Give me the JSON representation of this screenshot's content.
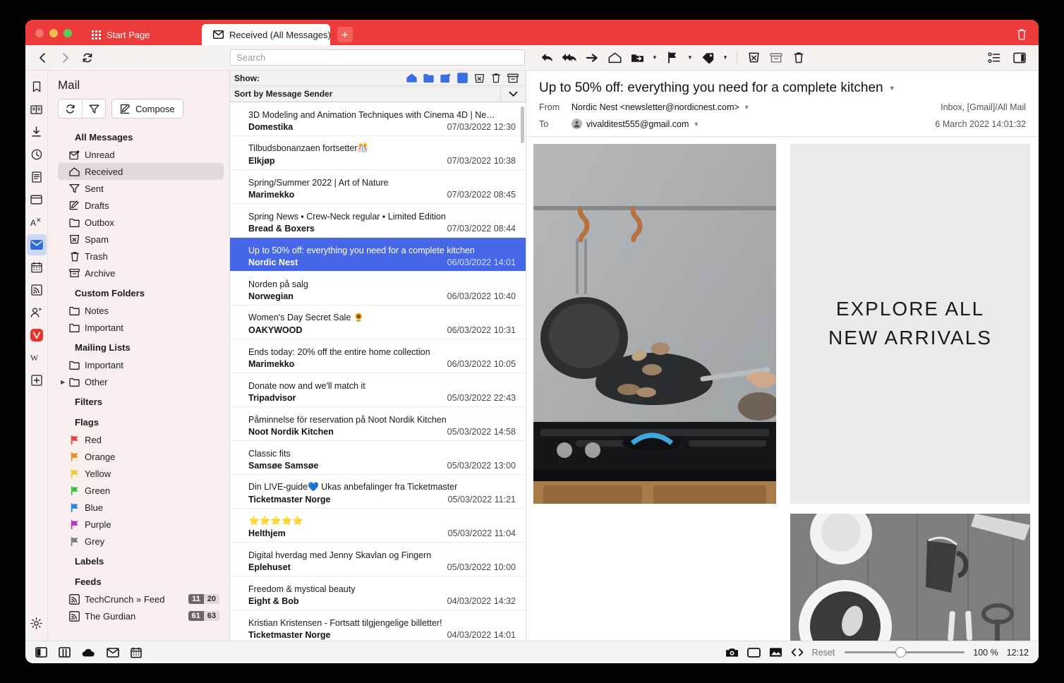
{
  "window": {
    "accent_color": "#ED3B3B",
    "selection_color": "#4668E8",
    "tabs": [
      {
        "label": "Start Page",
        "icon": "grid-icon",
        "active": false
      },
      {
        "label": "Received (All Messages)",
        "icon": "mail-icon",
        "active": true
      }
    ],
    "new_tab_label": "+",
    "trash_icon": "trash-icon"
  },
  "navbar": {
    "back": "back-arrow-icon",
    "forward": "forward-arrow-icon",
    "reload": "reload-icon",
    "search": {
      "value": "",
      "placeholder": "Search"
    }
  },
  "mail_toolbar": {
    "items": [
      {
        "name": "reply-button",
        "icon": "reply-icon"
      },
      {
        "name": "reply-all-button",
        "icon": "reply-all-icon"
      },
      {
        "name": "forward-button",
        "icon": "forward-icon"
      },
      {
        "name": "mark-unread-button",
        "icon": "open-envelope-icon"
      },
      {
        "name": "move-to-folder-button",
        "icon": "folder-move-icon",
        "has_caret": true
      },
      {
        "name": "flag-button",
        "icon": "flag-icon",
        "has_caret": true
      },
      {
        "name": "label-button",
        "icon": "tag-icon",
        "has_caret": true
      },
      {
        "name": "mark-spam-button",
        "icon": "spam-icon"
      },
      {
        "name": "archive-button",
        "icon": "archive-icon"
      },
      {
        "name": "delete-button",
        "icon": "trash-icon"
      }
    ],
    "right": [
      {
        "name": "message-list-options-button",
        "icon": "list-tree-icon"
      },
      {
        "name": "toggle-panel-button",
        "icon": "panel-toggle-icon"
      }
    ]
  },
  "rail": {
    "items": [
      {
        "name": "bookmarks",
        "icon": "bookmark-icon",
        "active": false
      },
      {
        "name": "reading-list",
        "icon": "book-icon",
        "active": false
      },
      {
        "name": "downloads",
        "icon": "download-icon",
        "active": false
      },
      {
        "name": "history",
        "icon": "clock-icon",
        "active": false
      },
      {
        "name": "notes",
        "icon": "notes-icon",
        "active": false
      },
      {
        "name": "window-panel",
        "icon": "window-icon",
        "active": false
      },
      {
        "name": "translate",
        "icon": "translate-icon",
        "active": false
      },
      {
        "name": "mail",
        "icon": "mail-icon",
        "active": true
      },
      {
        "name": "calendar",
        "icon": "calendar-icon",
        "active": false
      },
      {
        "name": "feeds",
        "icon": "rss-icon",
        "active": false
      },
      {
        "name": "contacts",
        "icon": "contacts-icon",
        "active": false
      },
      {
        "name": "vivaldi-web-panel",
        "icon": "vivaldi-logo-icon",
        "active": false
      },
      {
        "name": "wikipedia-web-panel",
        "icon": "wikipedia-icon",
        "active": false
      },
      {
        "name": "add-web-panel",
        "icon": "plus-box-icon",
        "active": false
      }
    ],
    "settings": {
      "name": "settings",
      "icon": "gear-icon"
    }
  },
  "panel": {
    "title": "Mail",
    "actions": {
      "refresh": "refresh-icon",
      "filter": "filter-icon",
      "compose_label": "Compose",
      "compose_icon": "compose-icon"
    },
    "groups": [
      {
        "header": "All Messages",
        "items": [
          {
            "label": "Unread",
            "icon": "unread-mail-icon",
            "selected": false
          },
          {
            "label": "Received",
            "icon": "received-icon",
            "selected": true
          },
          {
            "label": "Sent",
            "icon": "sent-icon",
            "selected": false
          },
          {
            "label": "Drafts",
            "icon": "draft-icon",
            "selected": false
          },
          {
            "label": "Outbox",
            "icon": "folder-icon",
            "selected": false
          },
          {
            "label": "Spam",
            "icon": "spam-icon",
            "selected": false
          },
          {
            "label": "Trash",
            "icon": "trash-icon",
            "selected": false
          },
          {
            "label": "Archive",
            "icon": "archive-icon",
            "selected": false
          }
        ]
      },
      {
        "header": "Custom Folders",
        "items": [
          {
            "label": "Notes",
            "icon": "folder-icon",
            "selected": false
          },
          {
            "label": "Important",
            "icon": "folder-icon",
            "selected": false
          }
        ]
      },
      {
        "header": "Mailing Lists",
        "items": [
          {
            "label": "Important",
            "icon": "folder-icon",
            "selected": false
          },
          {
            "label": "Other",
            "icon": "folder-icon",
            "selected": false,
            "disclosure": true
          }
        ]
      },
      {
        "header": "Filters",
        "items": []
      },
      {
        "header": "Flags",
        "items": [
          {
            "label": "Red",
            "icon": "flag-icon",
            "color": "#E8453C",
            "selected": false
          },
          {
            "label": "Orange",
            "icon": "flag-icon",
            "color": "#F08B21",
            "selected": false
          },
          {
            "label": "Yellow",
            "icon": "flag-icon",
            "color": "#F2CB32",
            "selected": false
          },
          {
            "label": "Green",
            "icon": "flag-icon",
            "color": "#34C240",
            "selected": false
          },
          {
            "label": "Blue",
            "icon": "flag-icon",
            "color": "#2A82E8",
            "selected": false
          },
          {
            "label": "Purple",
            "icon": "flag-icon",
            "color": "#B333C6",
            "selected": false
          },
          {
            "label": "Grey",
            "icon": "flag-icon",
            "color": "#7C7C7C",
            "selected": false
          }
        ]
      },
      {
        "header": "Labels",
        "items": []
      },
      {
        "header": "Feeds",
        "items": [
          {
            "label": "TechCrunch » Feed",
            "icon": "rss-icon",
            "selected": false,
            "unread": "11",
            "total": "20"
          },
          {
            "label": "The Gurdian",
            "icon": "rss-icon",
            "selected": false,
            "unread": "61",
            "total": "63"
          }
        ]
      }
    ]
  },
  "message_list": {
    "show_label": "Show:",
    "show_filters": [
      {
        "name": "filter-received",
        "icon": "received-icon",
        "active": true
      },
      {
        "name": "filter-folders",
        "icon": "folder-icon",
        "active": true
      },
      {
        "name": "filter-unread",
        "icon": "unread-mail-icon",
        "active": true
      },
      {
        "name": "filter-feeds",
        "icon": "rss-icon",
        "active": true
      },
      {
        "name": "filter-spam",
        "icon": "spam-icon",
        "active": false
      },
      {
        "name": "filter-trash",
        "icon": "trash-icon",
        "active": false
      },
      {
        "name": "filter-archive",
        "icon": "archive-icon",
        "active": false
      }
    ],
    "sort_label": "Sort by Message Sender",
    "messages": [
      {
        "subject": "3D Modeling and Animation Techniques with Cinema 4D | Ne…",
        "sender": "Domestika",
        "date": "07/03/2022 12:30",
        "selected": false
      },
      {
        "subject": "Tilbudsbonanzaen fortsetter🎊",
        "sender": "Elkjøp",
        "date": "07/03/2022 10:38",
        "selected": false
      },
      {
        "subject": "Spring/Summer 2022 | Art of Nature",
        "sender": "Marimekko",
        "date": "07/03/2022 08:45",
        "selected": false
      },
      {
        "subject": "Spring News ▪ Crew-Neck regular ▪ Limited Edition",
        "sender": "Bread & Boxers",
        "date": "07/03/2022 08:44",
        "selected": false
      },
      {
        "subject": "Up to 50% off: everything you need for a complete kitchen",
        "sender": "Nordic Nest",
        "date": "06/03/2022 14:01",
        "selected": true
      },
      {
        "subject": "Norden på salg",
        "sender": "Norwegian",
        "date": "06/03/2022 10:40",
        "selected": false
      },
      {
        "subject": "Women's Day Secret Sale 🌻",
        "sender": "OAKYWOOD",
        "date": "06/03/2022 10:31",
        "selected": false
      },
      {
        "subject": "Ends today: 20% off the entire home collection",
        "sender": "Marimekko",
        "date": "06/03/2022 10:05",
        "selected": false
      },
      {
        "subject": "Donate now and we'll match it",
        "sender": "Tripadvisor",
        "date": "05/03/2022 22:43",
        "selected": false
      },
      {
        "subject": "Påminnelse för reservation på Noot Nordik Kitchen",
        "sender": "Noot Nordik Kitchen",
        "date": "05/03/2022 14:58",
        "selected": false
      },
      {
        "subject": "Classic fits",
        "sender": "Samsøe Samsøe",
        "date": "05/03/2022 13:00",
        "selected": false
      },
      {
        "subject": "Din LIVE-guide💙 Ukas anbefalinger fra Ticketmaster",
        "sender": "Ticketmaster Norge",
        "date": "05/03/2022 11:21",
        "selected": false
      },
      {
        "subject": "⭐⭐⭐⭐⭐",
        "sender": "Helthjem",
        "date": "05/03/2022 11:04",
        "selected": false
      },
      {
        "subject": "Digital hverdag med Jenny Skavlan og Fingern",
        "sender": "Eplehuset",
        "date": "05/03/2022 10:00",
        "selected": false
      },
      {
        "subject": "Freedom & mystical beauty",
        "sender": "Eight & Bob",
        "date": "04/03/2022 14:32",
        "selected": false
      },
      {
        "subject": "Kristian Kristensen - Fortsatt tilgjengelige billetter!",
        "sender": "Ticketmaster Norge",
        "date": "04/03/2022 14:01",
        "selected": false
      }
    ]
  },
  "reader": {
    "subject": "Up to 50% off: everything you need for a complete kitchen",
    "from_label": "From",
    "from_value": "Nordic Nest <newsletter@nordicnest.com>",
    "to_label": "To",
    "to_value": "vivalditest555@gmail.com",
    "folders": "Inbox, [Gmail]/All Mail",
    "timestamp": "6 March 2022 14:01:32",
    "body": {
      "hero_alt": "frying-pan-on-gas-stove-photo",
      "promo_text": "EXPLORE ALL\nNEW ARRIVALS",
      "promo_line1": "EXPLORE ALL",
      "promo_line2": "NEW ARRIVALS",
      "tile_blank_alt": "placeholder-tile",
      "tile_photo_alt": "tableware-on-wood-photo"
    }
  },
  "statusbar": {
    "left_icons": [
      {
        "name": "toggle-panel-button",
        "icon": "panel-toggle-icon"
      },
      {
        "name": "tiling-button",
        "icon": "tile-icon"
      },
      {
        "name": "sync-button",
        "icon": "cloud-icon"
      },
      {
        "name": "mail-status-button",
        "icon": "mail-icon"
      },
      {
        "name": "calendar-status-button",
        "icon": "calendar-icon"
      }
    ],
    "right_icons": [
      {
        "name": "capture-page-button",
        "icon": "camera-icon"
      },
      {
        "name": "page-actions-button",
        "icon": "rectangle-icon"
      },
      {
        "name": "image-toggle-button",
        "icon": "image-icon"
      },
      {
        "name": "developer-tools-button",
        "icon": "code-icon"
      }
    ],
    "reset_label": "Reset",
    "zoom_level": "100 %",
    "time": "12:12"
  }
}
